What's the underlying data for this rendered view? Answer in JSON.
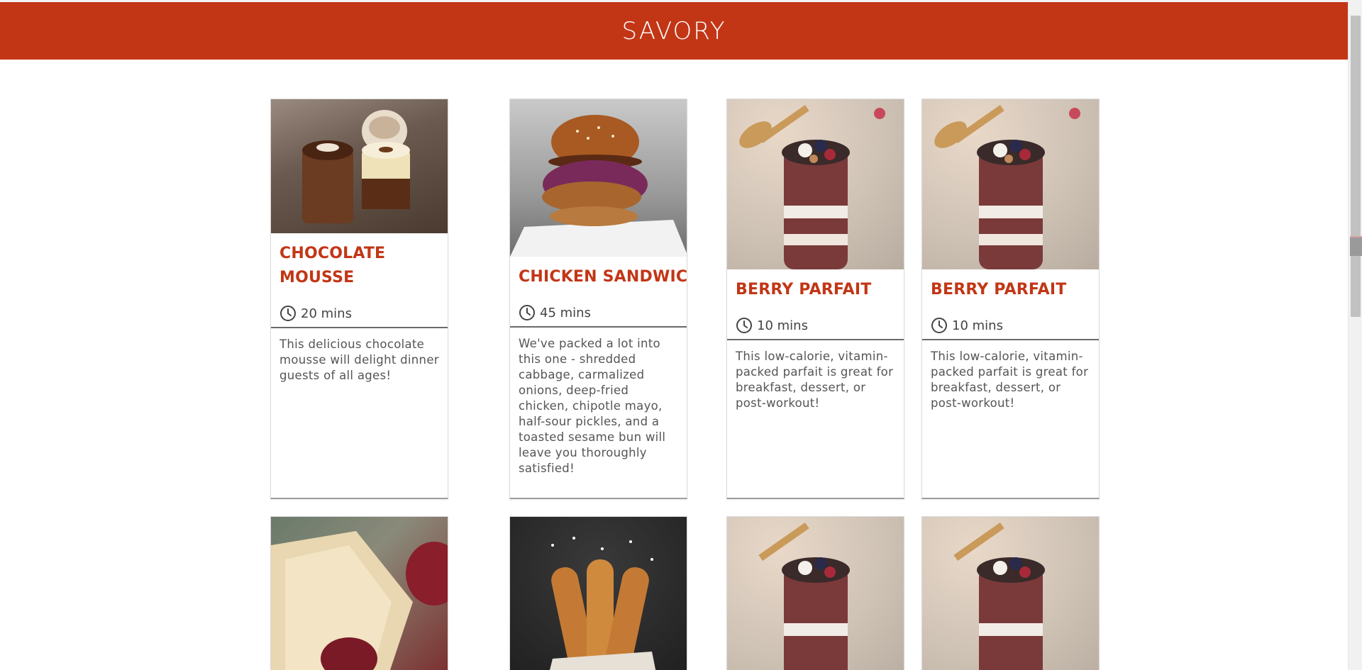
{
  "header": {
    "title": "SAVORY"
  },
  "cards": [
    {
      "name": "CHOCOLATE MOUSSE",
      "time": "20 mins",
      "description": "This delicious chocolate mousse will delight dinner guests of all ages!"
    },
    {
      "name": "CHICKEN SANDWICH",
      "time": "45 mins",
      "description": "We've packed a lot into this one - shredded cabbage, carmalized onions, deep-fried chicken, chipotle mayo, half-sour pickles, and a toasted sesame bun will leave you thoroughly satisfied!"
    },
    {
      "name": "BERRY PARFAIT",
      "time": "10 mins",
      "description": "This low-calorie, vitamin-packed parfait is great for breakfast, dessert, or post-workout!"
    },
    {
      "name": "BERRY PARFAIT",
      "time": "10 mins",
      "description": "This low-calorie, vitamin-packed parfait is great for breakfast, dessert, or post-workout!"
    }
  ],
  "icons": {
    "clock": "clock-icon"
  },
  "colors": {
    "accent": "#c23616",
    "text": "#555555"
  }
}
